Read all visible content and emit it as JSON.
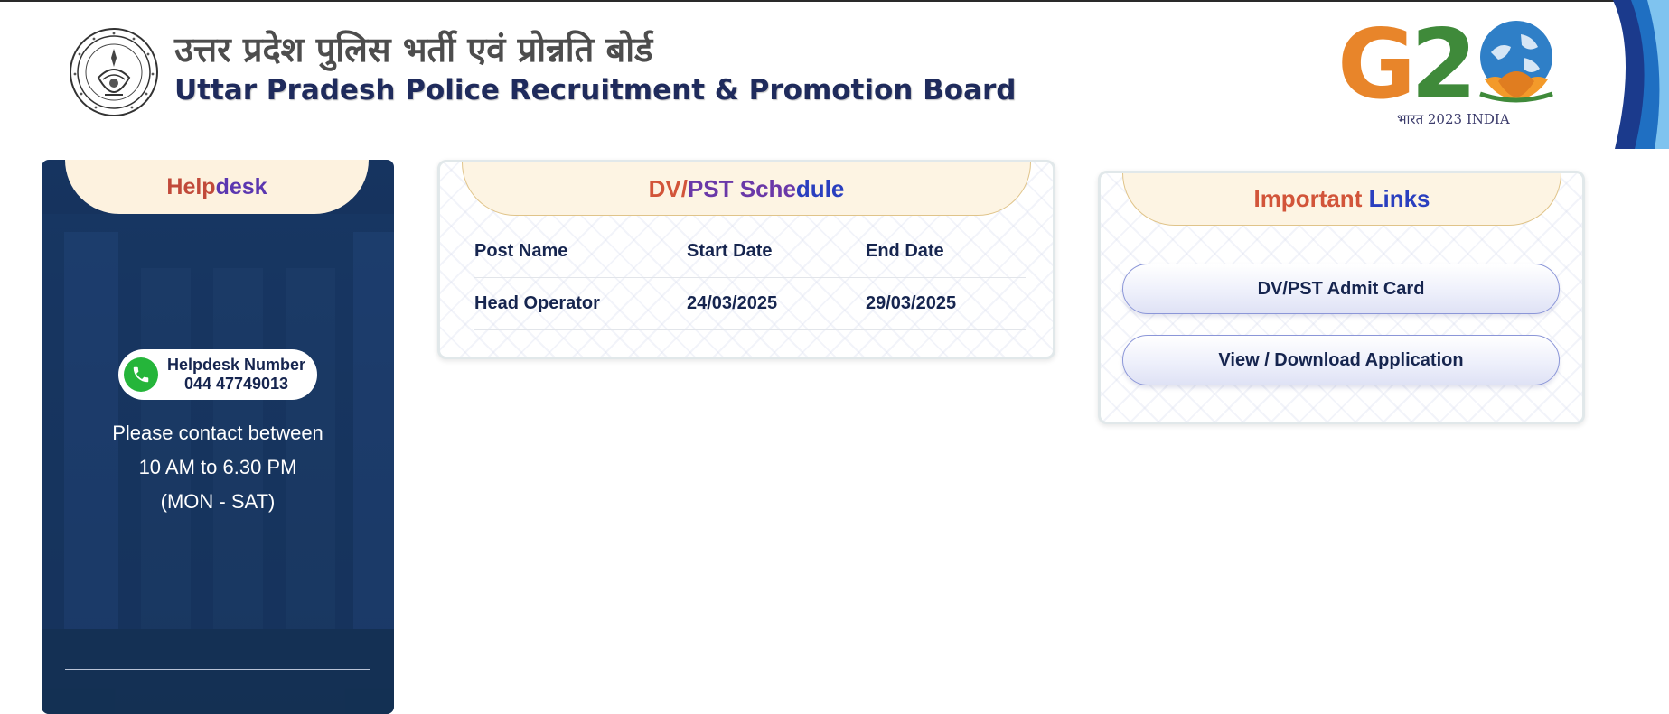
{
  "header": {
    "title_hindi": "उत्तर प्रदेश पुलिस भर्ती एवं प्रोन्नति बोर्ड",
    "title_english": "Uttar Pradesh Police Recruitment & Promotion Board",
    "g20_logo_text": "G20",
    "g20_subtitle": "भारत 2023 INDIA"
  },
  "helpdesk": {
    "title_part1": "Help",
    "title_part2": "desk",
    "number_label": "Helpdesk Number",
    "number": "044 47749013",
    "contact_line1": "Please contact between",
    "contact_line2": "10 AM to 6.30 PM",
    "contact_line3": "(MON - SAT)"
  },
  "schedule": {
    "title_part1": "DV/",
    "title_part2": "PST Sche",
    "title_part3": "dule",
    "columns": [
      "Post Name",
      "Start Date",
      "End Date"
    ],
    "rows": [
      {
        "post": "Head Operator",
        "start": "24/03/2025",
        "end": "29/03/2025"
      }
    ]
  },
  "important_links": {
    "title_part1": "Important",
    "title_part2": "Links",
    "links": [
      {
        "label": "DV/PST Admit Card"
      },
      {
        "label": "View / Download Application"
      }
    ]
  },
  "colors": {
    "navy": "#16254f",
    "helpdesk_bg": "#163460",
    "tab_bg": "#fdf2df",
    "accent_red": "#c14a3a",
    "accent_purple": "#6a38a8",
    "phone_green": "#25b53a"
  }
}
